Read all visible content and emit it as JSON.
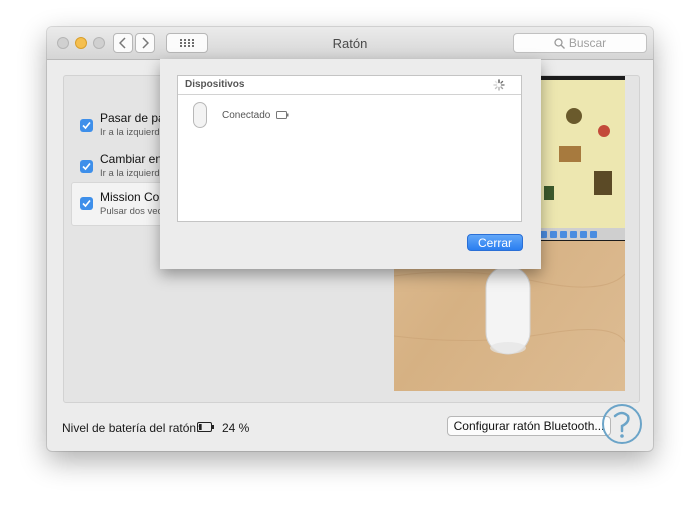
{
  "window": {
    "title": "Ratón",
    "search_placeholder": "Buscar"
  },
  "options": [
    {
      "title": "Pasar de pá",
      "subtitle": "Ir a la izquierd",
      "checked": true
    },
    {
      "title": "Cambiar ent",
      "subtitle": "Ir a la izquierd",
      "checked": true
    },
    {
      "title": "Mission Con",
      "subtitle": "Pulsar dos vec",
      "checked": true
    }
  ],
  "footer": {
    "battery_label": "Nivel de batería del ratón:",
    "battery_value": "24 %",
    "battery_level": 0.24,
    "config_button": "Configurar ratón Bluetooth..."
  },
  "sheet": {
    "header": "Dispositivos",
    "device_status": "Conectado",
    "close_button": "Cerrar"
  },
  "colors": {
    "accent": "#3e8fea",
    "button_blue": "#2a7ef0"
  },
  "icons": [
    "back-arrow-icon",
    "forward-arrow-icon",
    "grid-icon",
    "search-icon",
    "checkmark-icon",
    "battery-icon",
    "spinner-icon",
    "mouse-icon"
  ]
}
